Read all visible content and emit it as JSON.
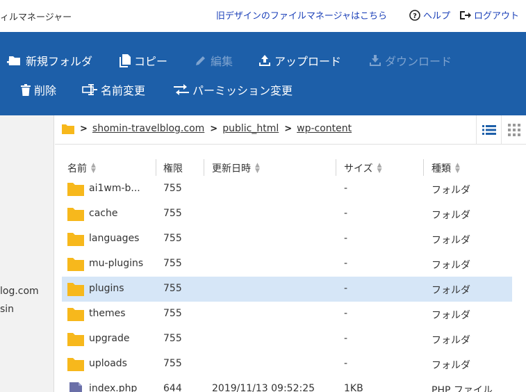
{
  "header": {
    "title": "ィルマネージャー",
    "old_link": "旧デザインのファイルマネージャはこちら",
    "help": "ヘルプ",
    "logout": "ログアウト"
  },
  "toolbar": {
    "new_folder": "新規フォルダ",
    "copy": "コピー",
    "edit": "編集",
    "upload": "アップロード",
    "download": "ダウンロード",
    "delete": "削除",
    "rename": "名前変更",
    "permission": "パーミッション変更"
  },
  "left_panel": {
    "line1": "log.com",
    "line2": "sin"
  },
  "breadcrumb": [
    "shomin-travelblog.com",
    "public_html",
    "wp-content"
  ],
  "columns": [
    "名前",
    "権限",
    "更新日時",
    "サイズ",
    "種類"
  ],
  "rows": [
    {
      "name": "ai1wm-b...",
      "perm": "755",
      "date": "",
      "size": "-",
      "kind": "フォルダ",
      "icon": "folder-icon"
    },
    {
      "name": "cache",
      "perm": "755",
      "date": "",
      "size": "-",
      "kind": "フォルダ",
      "icon": "folder-icon"
    },
    {
      "name": "languages",
      "perm": "755",
      "date": "",
      "size": "-",
      "kind": "フォルダ",
      "icon": "folder-icon"
    },
    {
      "name": "mu-plugins",
      "perm": "755",
      "date": "",
      "size": "-",
      "kind": "フォルダ",
      "icon": "folder-icon"
    },
    {
      "name": "plugins",
      "perm": "755",
      "date": "",
      "size": "-",
      "kind": "フォルダ",
      "icon": "folder-icon"
    },
    {
      "name": "themes",
      "perm": "755",
      "date": "",
      "size": "-",
      "kind": "フォルダ",
      "icon": "folder-icon"
    },
    {
      "name": "upgrade",
      "perm": "755",
      "date": "",
      "size": "-",
      "kind": "フォルダ",
      "icon": "folder-icon"
    },
    {
      "name": "uploads",
      "perm": "755",
      "date": "",
      "size": "-",
      "kind": "フォルダ",
      "icon": "folder-icon"
    },
    {
      "name": "index.php",
      "perm": "644",
      "date": "2019/11/13 09:52:25",
      "size": "1KB",
      "kind": "PHP ファイル",
      "icon": "php-file-icon"
    }
  ],
  "selected_row": "plugins",
  "colors": {
    "toolbar_bg": "#1d5fa9",
    "link": "#1a3fb8",
    "folder": "#f7b81c",
    "selected_row": "#d6e6f7",
    "disabled": "#7ea3cf"
  }
}
